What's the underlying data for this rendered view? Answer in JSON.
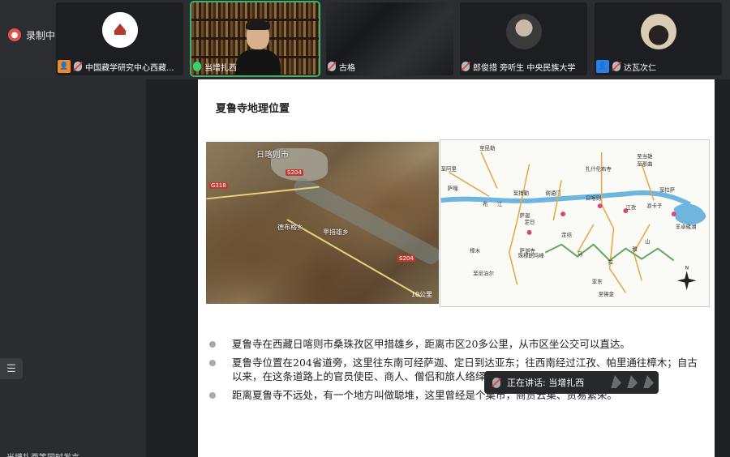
{
  "recording": {
    "label": "录制中"
  },
  "participants": [
    {
      "name": "中国藏学研究中心西藏...",
      "badge": "orange",
      "mic": "muted"
    },
    {
      "name": "当增扎西",
      "mic": "on",
      "active": true
    },
    {
      "name": "古格",
      "mic": "muted"
    },
    {
      "name": "郎俊措 旁听生 中央民族大学",
      "mic": "muted"
    },
    {
      "name": "达瓦次仁",
      "badge": "blue",
      "mic": "muted"
    }
  ],
  "slide": {
    "title": "夏鲁寺地理位置",
    "satellite": {
      "city": "日喀则市",
      "road_tags": [
        "G318",
        "S204",
        "S204"
      ],
      "places": [
        "德布格乡",
        "甲措雄乡"
      ],
      "scale": "10公里"
    },
    "map": {
      "labels": [
        "至昆勒",
        "至阿里",
        "萨嘎",
        "江",
        "至措勤",
        "至那曲",
        "萨迦",
        "布",
        "定日",
        "谢通门",
        "日喀则",
        "扎什伦布寺",
        "江孜",
        "浪卡子",
        "至当雄",
        "至拉萨",
        "羊卓雍湖",
        "樟木",
        "至尼泊尔",
        "定结",
        "珠穆朗玛峰",
        "马",
        "拉",
        "雅",
        "山",
        "亚东",
        "至锡金",
        "萨迦寺"
      ]
    },
    "bullets": [
      "夏鲁寺在西藏日喀则市桑珠孜区甲措雄乡，距离市区20多公里，从市区坐公交可以直达。",
      "夏鲁寺位置在204省道旁，这里往东南可经萨迦、定日到达亚东；往西南经过江孜、帕里通往樟木；自古以来，在这条道路上的官员使臣、商人、僧侣和旅人络绎不绝，络绎不绝。",
      "距离夏鲁寺不远处，有一个地方叫做聪堆，这里曾经是个集市，商贾云集、贸易繁荣。"
    ]
  },
  "toast": {
    "text": "正在讲话: 当增扎西"
  },
  "bottom_caption": "当增扎西等同时发言",
  "colors": {
    "active_border": "#3bb36a",
    "badge_orange": "#f08a24",
    "badge_blue": "#2f7ee6"
  }
}
